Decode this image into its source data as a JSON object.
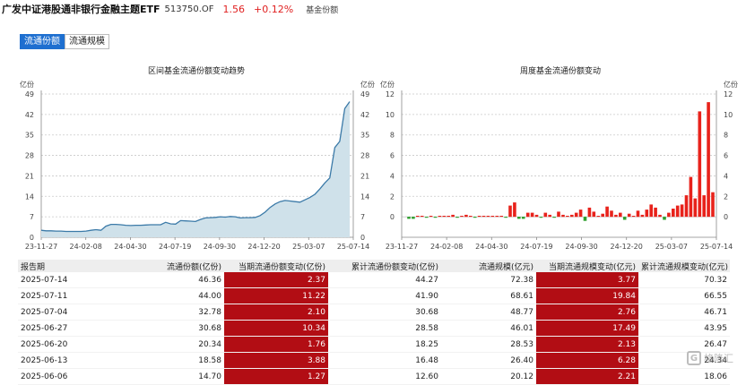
{
  "header": {
    "name": "广发中证港股通非银行金融主题ETF",
    "code": "513750.OF",
    "price": "1.56",
    "change": "+0.12%",
    "tag": "基金份额"
  },
  "tabs": [
    {
      "label": "流通份额",
      "active": true
    },
    {
      "label": "流通规模",
      "active": false
    }
  ],
  "colors": {
    "accent": "#1e6fd0",
    "line": "#3b7aa8",
    "area": "#cfe1ea",
    "up": "#e8221b",
    "down": "#2ca02c",
    "cell": "#b20d14"
  },
  "chart_data": [
    {
      "type": "area",
      "title": "区间基金流通份额变动趋势",
      "ylabel_left": "亿份",
      "ylabel_right": "亿份",
      "ylim": [
        0,
        49
      ],
      "yticks": [
        0,
        7,
        14,
        21,
        28,
        35,
        42,
        49
      ],
      "xticks": [
        "23-11-27",
        "24-02-08",
        "24-04-30",
        "24-07-19",
        "24-09-30",
        "24-12-20",
        "25-03-07",
        "25-07-14"
      ],
      "grid": true,
      "series": [
        {
          "values": [
            2.4,
            2.2,
            2.2,
            2.1,
            2.1,
            2.0,
            2.0,
            2.0,
            2.0,
            2.1,
            2.4,
            2.6,
            2.4,
            3.8,
            4.4,
            4.4,
            4.3,
            4.1,
            4.0,
            4.1,
            4.1,
            4.2,
            4.3,
            4.3,
            4.3,
            5.1,
            4.6,
            4.5,
            5.7,
            5.6,
            5.5,
            5.4,
            6.1,
            6.6,
            6.7,
            6.8,
            7.0,
            6.9,
            7.1,
            7.0,
            6.6,
            6.7,
            6.7,
            6.8,
            7.4,
            8.6,
            10.2,
            11.4,
            12.2,
            12.6,
            12.4,
            12.2,
            12.0,
            12.8,
            13.6,
            14.7,
            16.5,
            18.6,
            20.3,
            30.7,
            32.8,
            44.0,
            46.4
          ]
        }
      ]
    },
    {
      "type": "bar",
      "title": "周度基金流通份额变动",
      "ylabel_left": "亿份",
      "ylabel_right": "亿份",
      "ylim": [
        -2,
        12
      ],
      "yticks": [
        0,
        2,
        4,
        6,
        8,
        10,
        12
      ],
      "xticks": [
        "23-11-27",
        "24-02-08",
        "24-04-30",
        "24-07-19",
        "24-09-30",
        "24-12-20",
        "25-03-07",
        "25-07-14"
      ],
      "grid": true,
      "series": [
        {
          "values": [
            -0.2,
            -0.2,
            0.1,
            0.1,
            -0.1,
            0.1,
            -0.1,
            0.1,
            0.1,
            0.1,
            0.2,
            -0.1,
            0.1,
            0.2,
            0.1,
            -0.1,
            0.1,
            0.1,
            0.1,
            0.1,
            0.1,
            0.1,
            -0.1,
            1.1,
            1.4,
            -0.2,
            -0.2,
            0.4,
            0.4,
            0.2,
            -0.1,
            0.4,
            0.2,
            -0.1,
            0.5,
            0.2,
            0.1,
            0.2,
            0.4,
            0.7,
            -0.4,
            0.9,
            0.5,
            0.1,
            0.3,
            1.0,
            0.6,
            0.2,
            0.4,
            -0.3,
            0.3,
            0.1,
            0.6,
            0.2,
            0.7,
            1.2,
            0.9,
            0.2,
            -0.3,
            0.4,
            0.8,
            1.1,
            1.2,
            2.1,
            3.9,
            1.8,
            10.3,
            2.1,
            11.2,
            2.4
          ]
        }
      ]
    }
  ],
  "table": {
    "headers": [
      "报告期",
      "流通份额(亿份)",
      "当期流通份额变动(亿份)",
      "累计流通份额变动(亿份)",
      "流通规模(亿元)",
      "当期流通规模变动(亿元)",
      "累计流通规模变动(亿元)"
    ],
    "rows": [
      [
        "2025-07-14",
        "46.36",
        "2.37",
        "44.27",
        "72.38",
        "3.77",
        "70.32"
      ],
      [
        "2025-07-11",
        "44.00",
        "11.22",
        "41.90",
        "68.61",
        "19.84",
        "66.55"
      ],
      [
        "2025-07-04",
        "32.78",
        "2.10",
        "30.68",
        "48.77",
        "2.76",
        "46.71"
      ],
      [
        "2025-06-27",
        "30.68",
        "10.34",
        "28.58",
        "46.01",
        "17.49",
        "43.95"
      ],
      [
        "2025-06-20",
        "20.34",
        "1.76",
        "18.25",
        "28.53",
        "2.13",
        "26.47"
      ],
      [
        "2025-06-13",
        "18.58",
        "3.88",
        "16.48",
        "26.40",
        "6.28",
        "24.34"
      ],
      [
        "2025-06-06",
        "14.70",
        "1.27",
        "12.60",
        "20.12",
        "2.21",
        "18.06"
      ]
    ]
  },
  "watermark": {
    "glyph": "G",
    "text": "格隆汇"
  }
}
